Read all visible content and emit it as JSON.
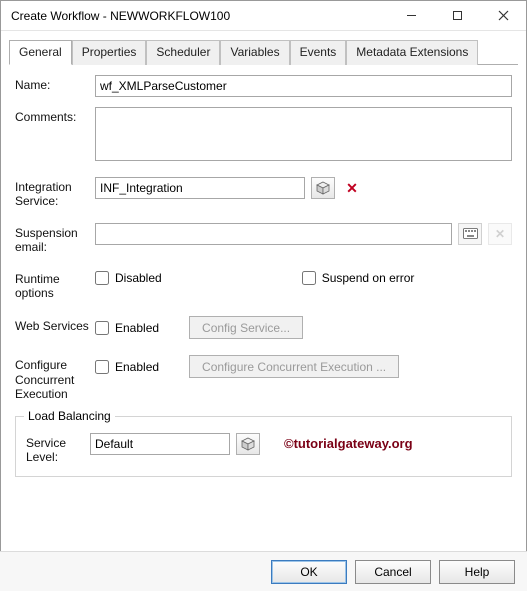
{
  "window": {
    "title": "Create Workflow - NEWWORKFLOW100"
  },
  "tabs": {
    "general": "General",
    "properties": "Properties",
    "scheduler": "Scheduler",
    "variables": "Variables",
    "events": "Events",
    "metadata": "Metadata Extensions"
  },
  "labels": {
    "name": "Name:",
    "comments": "Comments:",
    "integration": "Integration Service:",
    "suspension": "Suspension email:",
    "runtime": "Runtime options",
    "web": "Web Services",
    "concurrent": "Configure Concurrent Execution",
    "loadbalancing": "Load Balancing",
    "servicelevel": "Service Level:"
  },
  "fields": {
    "name": "wf_XMLParseCustomer",
    "comments": "",
    "integration": "INF_Integration",
    "suspension": "",
    "servicelevel": "Default"
  },
  "checkboxes": {
    "disabled": "Disabled",
    "suspend": "Suspend on error",
    "webenabled": "Enabled",
    "concurenabled": "Enabled"
  },
  "buttons": {
    "configservice": "Config Service...",
    "configconcur": "Configure Concurrent Execution ...",
    "ok": "OK",
    "cancel": "Cancel",
    "help": "Help"
  },
  "watermark": "©tutorialgateway.org"
}
